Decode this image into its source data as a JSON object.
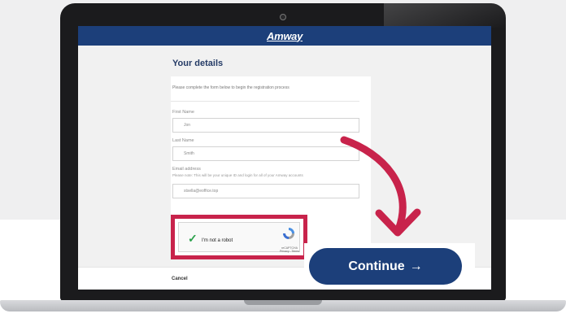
{
  "brand": {
    "name": "Amway"
  },
  "form": {
    "title": "Your details",
    "intro": "Please complete the form below to begin the registration process",
    "first_name": {
      "label": "First Name",
      "value": "Jon"
    },
    "last_name": {
      "label": "Last Name",
      "value": "Smith"
    },
    "email": {
      "label": "Email address",
      "note": "Please note: This will be your unique ID and login for all of your Amway accounts",
      "value": "stsella@eoffice.top"
    },
    "cancel_label": "Cancel"
  },
  "recaptcha": {
    "label": "I'm not a robot",
    "brand": "reCAPTCHA",
    "links": "Privacy - Terms"
  },
  "continue": {
    "label": "Continue",
    "arrow": "→"
  },
  "colors": {
    "brand_blue": "#1c3f7a",
    "highlight_red": "#c8234b",
    "check_green": "#2aa14b"
  },
  "icons": {
    "check": "check-icon",
    "recaptcha": "recaptcha-logo-icon",
    "arrow": "curved-arrow-icon"
  }
}
